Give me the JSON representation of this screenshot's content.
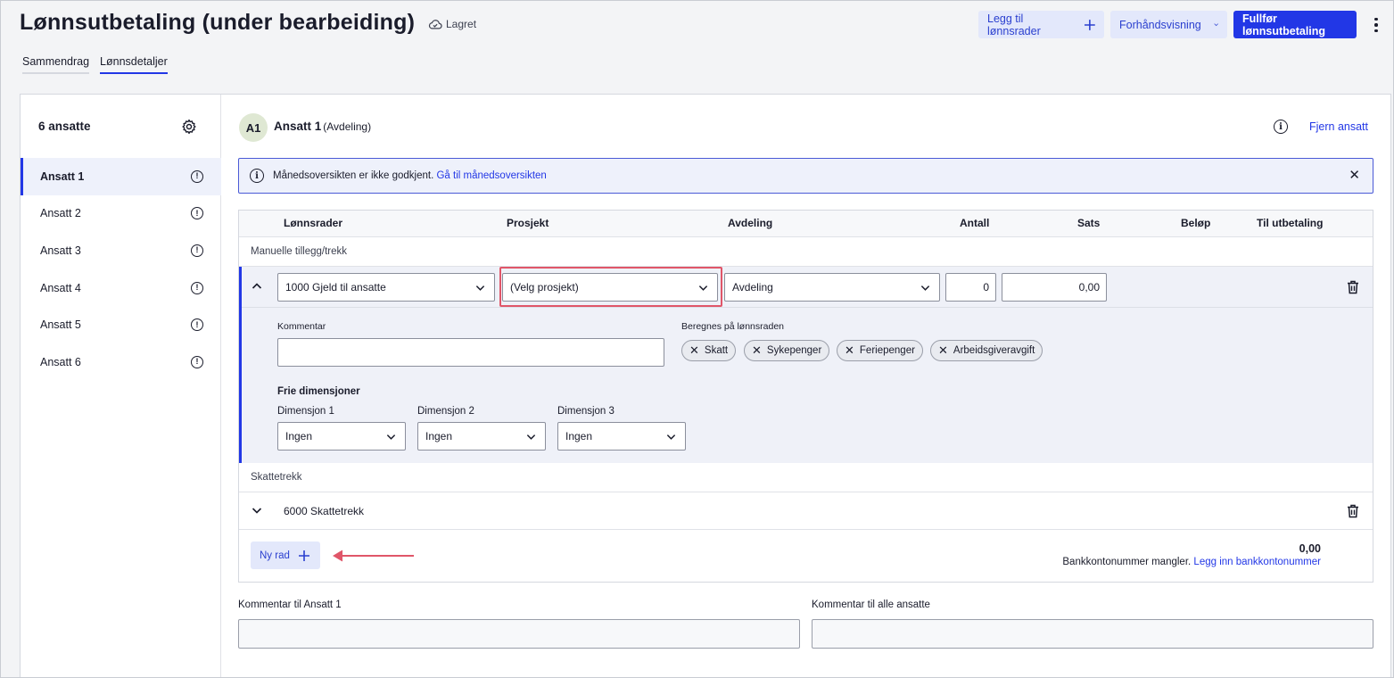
{
  "header": {
    "title": "Lønnsutbetaling (under bearbeiding)",
    "saved_status": "Lagret",
    "add_rows_label": "Legg til lønnsrader",
    "preview_label": "Forhåndsvisning",
    "finish_label": "Fullfør lønnsutbetaling"
  },
  "tabs": [
    {
      "label": "Sammendrag",
      "active": false
    },
    {
      "label": "Lønnsdetaljer",
      "active": true
    }
  ],
  "sidebar": {
    "heading": "6 ansatte",
    "items": [
      {
        "label": "Ansatt 1",
        "active": true
      },
      {
        "label": "Ansatt 2",
        "active": false
      },
      {
        "label": "Ansatt 3",
        "active": false
      },
      {
        "label": "Ansatt 4",
        "active": false
      },
      {
        "label": "Ansatt 5",
        "active": false
      },
      {
        "label": "Ansatt 6",
        "active": false
      }
    ]
  },
  "employee": {
    "initials": "A1",
    "name": "Ansatt 1",
    "department": "(Avdeling)",
    "remove_label": "Fjern ansatt"
  },
  "alert": {
    "message": "Månedsoversikten er ikke godkjent.",
    "link": "Gå til månedsoversikten"
  },
  "table": {
    "columns": {
      "rows": "Lønnsrader",
      "project": "Prosjekt",
      "department": "Avdeling",
      "quantity": "Antall",
      "rate": "Sats",
      "amount": "Beløp",
      "payout": "Til utbetaling"
    },
    "section_manual": "Manuelle tillegg/trekk",
    "manual_row": {
      "pay_item": "1000 Gjeld til ansatte",
      "project": "(Velg prosjekt)",
      "department": "Avdeling",
      "quantity": "0",
      "rate": "0,00",
      "comment_label": "Kommentar",
      "calc_label": "Beregnes på lønnsraden",
      "chips": [
        "Skatt",
        "Sykepenger",
        "Feriepenger",
        "Arbeidsgiveravgift"
      ],
      "free_dims_label": "Frie dimensjoner",
      "dims": [
        {
          "label": "Dimensjon 1",
          "value": "Ingen"
        },
        {
          "label": "Dimensjon 2",
          "value": "Ingen"
        },
        {
          "label": "Dimensjon 3",
          "value": "Ingen"
        }
      ]
    },
    "section_tax": "Skattetrekk",
    "tax_row": {
      "label": "6000 Skattetrekk"
    },
    "new_row_label": "Ny rad",
    "total": "0,00",
    "bank_missing": "Bankkontonummer mangler.",
    "bank_link": "Legg inn bankkontonummer"
  },
  "comments": {
    "employee_label": "Kommentar til Ansatt 1",
    "all_label": "Kommentar til alle ansatte"
  },
  "colors": {
    "accent": "#2237e6",
    "highlight": "#e05669"
  }
}
